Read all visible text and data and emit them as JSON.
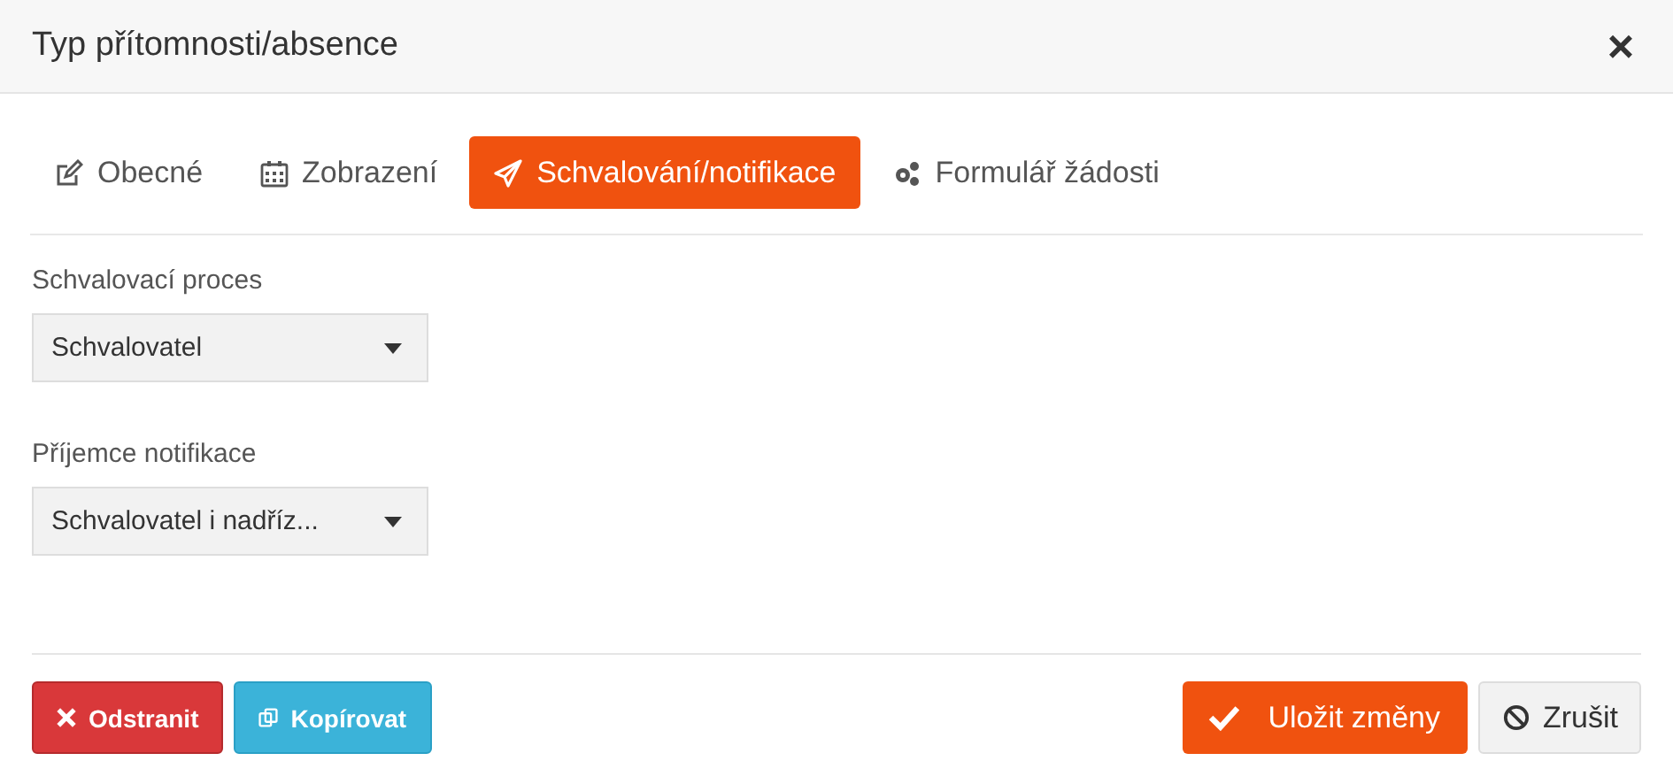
{
  "window": {
    "title": "Typ přítomnosti/absence",
    "close": "×"
  },
  "tabs": [
    {
      "label": "Obecné",
      "selected": false
    },
    {
      "label": "Zobrazení",
      "selected": false
    },
    {
      "label": "Schvalování/notifikace",
      "selected": true
    },
    {
      "label": "Formulář žádosti",
      "selected": false
    }
  ],
  "fields": [
    {
      "label": "Schvalovací proces",
      "value": "Schvalovatel"
    },
    {
      "label": "Příjemce notifikace",
      "value": "Schvalovatel i nadříz..."
    }
  ],
  "buttons_left": [
    {
      "label": "Odstranit",
      "kind": "danger"
    },
    {
      "label": "Kopírovat",
      "kind": "info"
    }
  ],
  "buttons_right": [
    {
      "label": "Uložit změny",
      "kind": "primary"
    },
    {
      "label": "Zrušit",
      "kind": "default"
    }
  ]
}
